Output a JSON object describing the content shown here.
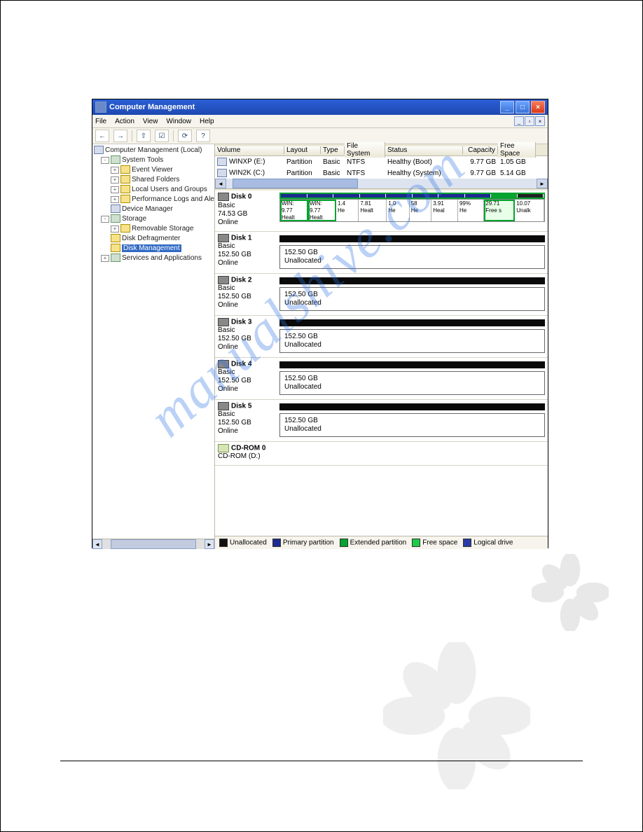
{
  "window": {
    "title": "Computer Management"
  },
  "menu": {
    "items": [
      "File",
      "Action",
      "View",
      "Window",
      "Help"
    ]
  },
  "toolbar": {
    "back": "←",
    "fwd": "→",
    "up": "⇧",
    "props": "☑",
    "refresh": "⟳",
    "help": "?"
  },
  "tree": {
    "root": "Computer Management (Local)",
    "system_tools": "System Tools",
    "event_viewer": "Event Viewer",
    "shared_folders": "Shared Folders",
    "local_users": "Local Users and Groups",
    "perf_logs": "Performance Logs and Alerts",
    "device_mgr": "Device Manager",
    "storage": "Storage",
    "removable": "Removable Storage",
    "defrag": "Disk Defragmenter",
    "disk_mgmt": "Disk Management",
    "services": "Services and Applications"
  },
  "vol_headers": {
    "volume": "Volume",
    "layout": "Layout",
    "type": "Type",
    "fs": "File System",
    "status": "Status",
    "capacity": "Capacity",
    "free": "Free Space"
  },
  "volumes": [
    {
      "name": "WINXP (E:)",
      "layout": "Partition",
      "type": "Basic",
      "fs": "NTFS",
      "status": "Healthy (Boot)",
      "capacity": "9.77 GB",
      "free": "1.05 GB"
    },
    {
      "name": "WIN2K (C:)",
      "layout": "Partition",
      "type": "Basic",
      "fs": "NTFS",
      "status": "Healthy (System)",
      "capacity": "9.77 GB",
      "free": "5.14 GB"
    }
  ],
  "disk0": {
    "title": "Disk 0",
    "type": "Basic",
    "size": "74.53 GB",
    "status": "Online",
    "cells": [
      {
        "l1": "WIN:",
        "l2": "9.77",
        "l3": "Healt"
      },
      {
        "l1": "WIN:",
        "l2": "9.77",
        "l3": "Healt"
      },
      {
        "l1": "1.4",
        "l2": "",
        "l3": "He"
      },
      {
        "l1": "7.81",
        "l2": "",
        "l3": "Healt"
      },
      {
        "l1": "1.0",
        "l2": "",
        "l3": "He"
      },
      {
        "l1": "58",
        "l2": "",
        "l3": "He"
      },
      {
        "l1": "3.91",
        "l2": "",
        "l3": "Heal"
      },
      {
        "l1": "99%",
        "l2": "",
        "l3": "He"
      },
      {
        "l1": "29.71",
        "l2": "",
        "l3": "Free s"
      },
      {
        "l1": "10.07",
        "l2": "",
        "l3": "Unalk"
      }
    ]
  },
  "disks": [
    {
      "title": "Disk 1",
      "type": "Basic",
      "size": "152.50 GB",
      "status": "Online",
      "psize": "152.50 GB",
      "pstat": "Unallocated"
    },
    {
      "title": "Disk 2",
      "type": "Basic",
      "size": "152.50 GB",
      "status": "Online",
      "psize": "152.50 GB",
      "pstat": "Unallocated"
    },
    {
      "title": "Disk 3",
      "type": "Basic",
      "size": "152.50 GB",
      "status": "Online",
      "psize": "152.50 GB",
      "pstat": "Unallocated"
    },
    {
      "title": "Disk 4",
      "type": "Basic",
      "size": "152.50 GB",
      "status": "Online",
      "psize": "152.50 GB",
      "pstat": "Unallocated"
    },
    {
      "title": "Disk 5",
      "type": "Basic",
      "size": "152.50 GB",
      "status": "Online",
      "psize": "152.50 GB",
      "pstat": "Unallocated"
    }
  ],
  "cdrom": {
    "title": "CD-ROM 0",
    "sub": "CD-ROM (D:)"
  },
  "legend": {
    "unalloc": "Unallocated",
    "primary": "Primary partition",
    "extended": "Extended partition",
    "free": "Free space",
    "logical": "Logical drive"
  },
  "watermark": "manualshive.com"
}
